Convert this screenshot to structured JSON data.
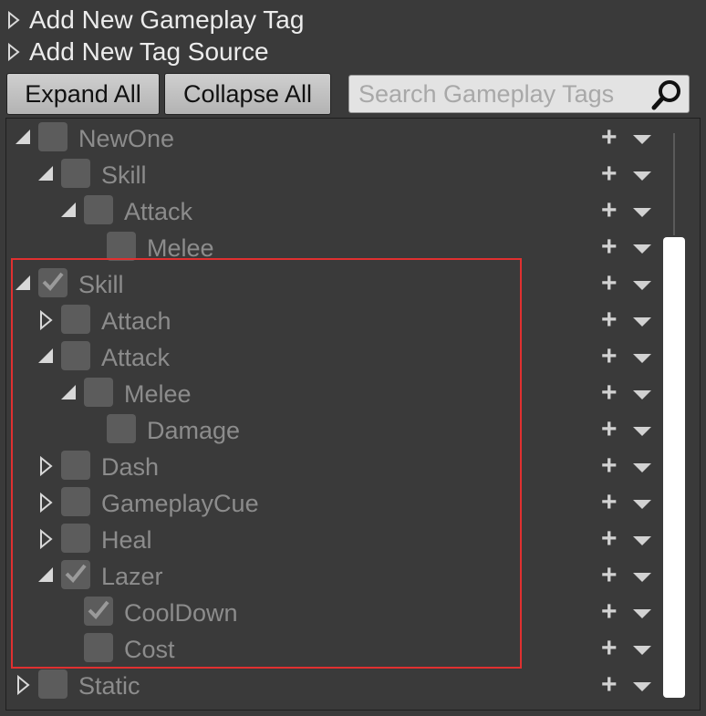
{
  "menu": {
    "add_tag": "Add New Gameplay Tag",
    "add_source": "Add New Tag Source"
  },
  "toolbar": {
    "expand_all": "Expand All",
    "collapse_all": "Collapse All"
  },
  "search": {
    "placeholder": "Search Gameplay Tags",
    "value": ""
  },
  "add_symbol": "+",
  "colors": {
    "background": "#3a3a3a",
    "label": "#8c8c8c",
    "highlight_border": "#e03030",
    "scrollbar": "#ffffff"
  },
  "tree": [
    {
      "label": "NewOne",
      "depth": 0,
      "expander": "expanded",
      "checked": false
    },
    {
      "label": "Skill",
      "depth": 1,
      "expander": "expanded",
      "checked": false
    },
    {
      "label": "Attack",
      "depth": 2,
      "expander": "expanded",
      "checked": false
    },
    {
      "label": "Melee",
      "depth": 3,
      "expander": "none",
      "checked": false
    },
    {
      "label": "Skill",
      "depth": 0,
      "expander": "expanded",
      "checked": true
    },
    {
      "label": "Attach",
      "depth": 1,
      "expander": "collapsed",
      "checked": false
    },
    {
      "label": "Attack",
      "depth": 1,
      "expander": "expanded",
      "checked": false
    },
    {
      "label": "Melee",
      "depth": 2,
      "expander": "expanded",
      "checked": false
    },
    {
      "label": "Damage",
      "depth": 3,
      "expander": "none",
      "checked": false
    },
    {
      "label": "Dash",
      "depth": 1,
      "expander": "collapsed",
      "checked": false
    },
    {
      "label": "GameplayCue",
      "depth": 1,
      "expander": "collapsed",
      "checked": false
    },
    {
      "label": "Heal",
      "depth": 1,
      "expander": "collapsed",
      "checked": false
    },
    {
      "label": "Lazer",
      "depth": 1,
      "expander": "expanded",
      "checked": true
    },
    {
      "label": "CoolDown",
      "depth": 2,
      "expander": "none",
      "checked": true
    },
    {
      "label": "Cost",
      "depth": 2,
      "expander": "none",
      "checked": false
    },
    {
      "label": "Static",
      "depth": 0,
      "expander": "collapsed",
      "checked": false
    }
  ]
}
